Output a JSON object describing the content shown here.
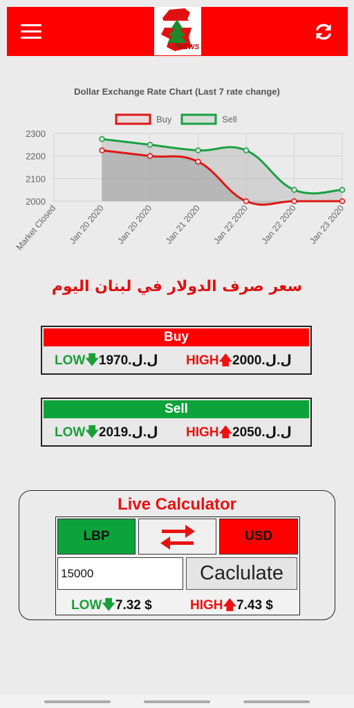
{
  "header": {
    "menu_icon": "hamburger-menu-icon",
    "logo_text": "NEWS",
    "refresh_icon": "refresh-icon",
    "accent_color": "#ff0000"
  },
  "chart_data": {
    "type": "line",
    "title": "Dollar Exchange Rate Chart (Last 7 rate change)",
    "categories": [
      "Market Closed",
      "Jan 20 2020",
      "Jan 20 2020",
      "Jan 21 2020",
      "Jan 22 2020",
      "Jan 22 2020",
      "Jan 23 2020"
    ],
    "series": [
      {
        "name": "Buy",
        "color": "#e01515",
        "values": [
          null,
          2225,
          2200,
          2175,
          2000,
          2000,
          2000
        ]
      },
      {
        "name": "Sell",
        "color": "#18a040",
        "values": [
          null,
          2275,
          2250,
          2225,
          2225,
          2050,
          2050
        ]
      }
    ],
    "y_ticks": [
      "2300",
      "2200",
      "2100",
      "2000"
    ],
    "ylim": [
      2000,
      2300
    ],
    "legend_position": "top",
    "grid": true
  },
  "arabic_title": "سعر صرف الدولار في لبنان اليوم",
  "buy": {
    "title": "Buy",
    "low_label": "LOW",
    "low_value": "1970.ل.ل",
    "high_label": "HIGH",
    "high_value": "2000.ل.ل",
    "color": "#ff0000"
  },
  "sell": {
    "title": "Sell",
    "low_label": "LOW",
    "low_value": "2019.ل.ل",
    "high_label": "HIGH",
    "high_value": "2050.ل.ل",
    "color": "#0da33b"
  },
  "calculator": {
    "title": "Live Calculator",
    "from_currency": "LBP",
    "to_currency": "USD",
    "swap_icon": "swap-arrows-icon",
    "amount": "15000",
    "button_label": "Caclulate",
    "low_label": "LOW",
    "low_value": "7.32 $",
    "high_label": "HIGH",
    "high_value": "7.43 $",
    "from_color": "#0da33b",
    "to_color": "#ff0000"
  }
}
